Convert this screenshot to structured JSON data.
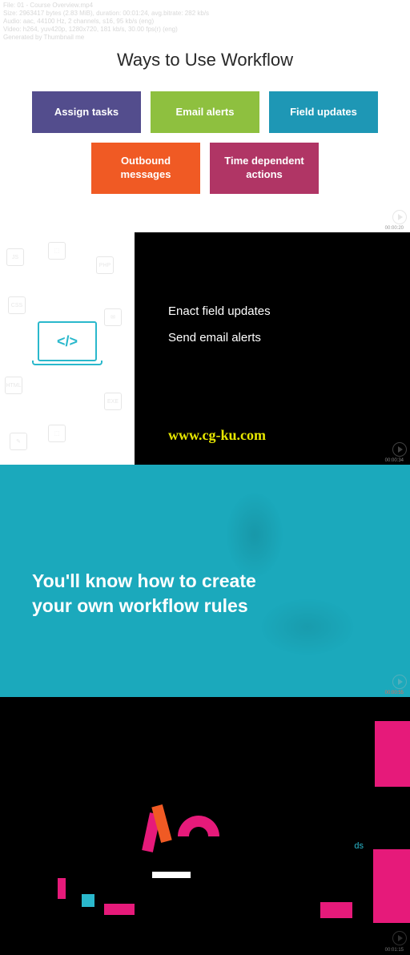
{
  "meta": {
    "file": "File: 01 - Course Overview.mp4",
    "size": "Size: 2963417 bytes (2.83 MiB), duration: 00:01:24, avg.bitrate: 282 kb/s",
    "audio": "Audio: aac, 44100 Hz, 2 channels, s16, 95 kb/s (eng)",
    "video": "Video: h264, yuv420p, 1280x720, 181 kb/s, 30.00 fps(r) (eng)",
    "gen": "Generated by Thumbnail me"
  },
  "panel1": {
    "title": "Ways to Use Workflow",
    "boxes": {
      "b1": "Assign tasks",
      "b2": "Email alerts",
      "b3": "Field updates",
      "b4": "Outbound\nmessages",
      "b5": "Time dependent\nactions"
    },
    "timestamp": "00:00:20"
  },
  "panel2": {
    "line1": "Enact field updates",
    "line2": "Send email alerts",
    "url": "www.cg-ku.com",
    "code_symbol": "</>",
    "timestamp": "00:00:34"
  },
  "panel3": {
    "line1": "You'll know how to create",
    "line2": "your own workflow rules",
    "timestamp": "00:00:55"
  },
  "panel4": {
    "text_fragment": "ds",
    "timestamp": "00:01:15"
  }
}
